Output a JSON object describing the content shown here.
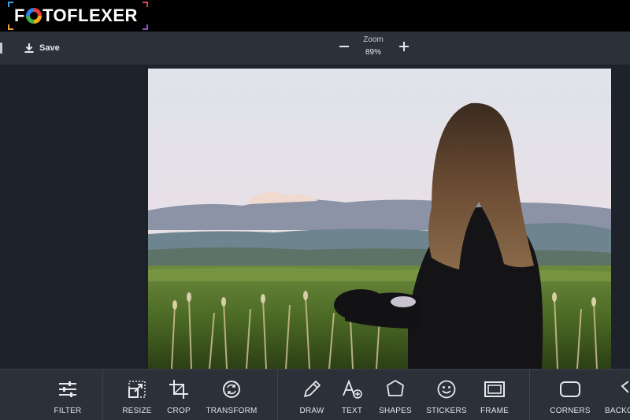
{
  "app": {
    "logo_text_prefix": "F",
    "logo_text_suffix": "TOFLEXER"
  },
  "toolbar": {
    "save_label": "Save"
  },
  "zoom": {
    "title": "Zoom",
    "value": "89%"
  },
  "tools": [
    {
      "label": "FILTER",
      "icon": "sliders-icon"
    },
    {
      "label": "RESIZE",
      "icon": "resize-icon"
    },
    {
      "label": "CROP",
      "icon": "crop-icon"
    },
    {
      "label": "TRANSFORM",
      "icon": "transform-icon"
    },
    {
      "label": "DRAW",
      "icon": "pencil-icon"
    },
    {
      "label": "TEXT",
      "icon": "text-icon"
    },
    {
      "label": "SHAPES",
      "icon": "shapes-icon"
    },
    {
      "label": "STICKERS",
      "icon": "smiley-icon"
    },
    {
      "label": "FRAME",
      "icon": "frame-icon"
    },
    {
      "label": "CORNERS",
      "icon": "corners-icon"
    },
    {
      "label": "BACKG",
      "icon": "background-icon"
    }
  ],
  "colors": {
    "accent": "#3aa3e3",
    "toolbar": "#2b3039",
    "header": "#000000"
  }
}
